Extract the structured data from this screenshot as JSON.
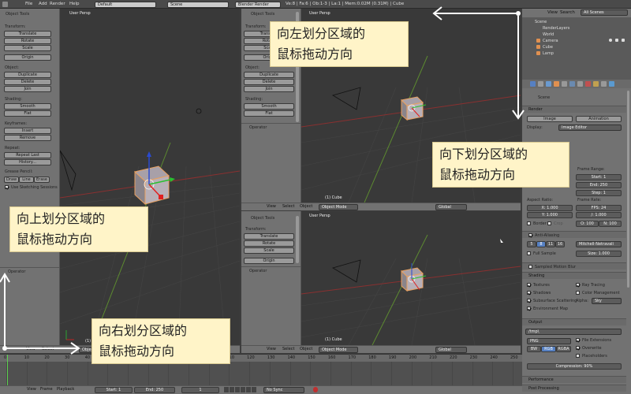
{
  "topbar": {
    "menus": [
      "File",
      "Add",
      "Render",
      "Help"
    ],
    "layout": "Default",
    "scene": "Scene",
    "engine": "Blender Render",
    "stats": "Ve:8 | Fa:6 | Ob:1-3 | La:1 | Mem:0.02M (0.31M) | Cube"
  },
  "tools_left": {
    "title": "Object Tools",
    "transform_label": "Transform:",
    "transform": [
      "Translate",
      "Rotate",
      "Scale"
    ],
    "origin": "Origin",
    "object_label": "Object:",
    "object": [
      "Duplicate",
      "Delete",
      "Join"
    ],
    "shading_label": "Shading:",
    "shading": [
      "Smooth",
      "Flat"
    ],
    "keyframes_label": "Keyframes:",
    "keyframes": [
      "Insert",
      "Remove"
    ],
    "repeat_label": "Repeat:",
    "repeat": [
      "Repeat Last",
      "History..."
    ],
    "grease_label": "Grease Pencil:",
    "grease": [
      "Draw",
      "Line",
      "Erase"
    ],
    "sketching": "Use Sketching Sessions",
    "operator": "Operator"
  },
  "tools_mid_top": {
    "title": "Object Tools",
    "transform_label": "Transform:",
    "transform": [
      "Translate",
      "Rotate",
      "Scale"
    ],
    "origin": "Origin",
    "object_label": "Object:",
    "object": [
      "Duplicate",
      "Delete",
      "Join"
    ],
    "shading_label": "Shading:",
    "shading": [
      "Smooth",
      "Flat"
    ],
    "operator": "Operator"
  },
  "tools_mid_bot": {
    "title": "Object Tools",
    "transform_label": "Transform:",
    "transform": [
      "Translate",
      "Rotate",
      "Scale"
    ],
    "origin": "Origin",
    "operator": "Operator"
  },
  "viewports": {
    "label": "User Persp",
    "cube_label": "(1) Cube",
    "menu_view": "View",
    "menu_select": "Select",
    "menu_object": "Object",
    "mode": "Object Mode",
    "orientation": "Global"
  },
  "outliner": {
    "view": "View",
    "search": "Search",
    "filter": "All Scenes",
    "items": [
      "Scene",
      "RenderLayers",
      "World",
      "Camera",
      "Cube",
      "Lamp"
    ]
  },
  "properties": {
    "breadcrumb": "Scene",
    "render": {
      "title": "Render",
      "image_btn": "Image",
      "animation_btn": "Animation",
      "display_label": "Display:",
      "display": "Image Editor"
    },
    "dimensions": {
      "frame_range": "Frame Range:",
      "start": "Start: 1",
      "end": "End: 250",
      "step": "Step: 1",
      "aspect": "Aspect Ratio:",
      "ax": "X: 1.000",
      "ay": "Y: 1.000",
      "frame_rate": "Frame Rate:",
      "fps": "FPS: 24",
      "fr": "/: 1.000",
      "border": "Border",
      "crop": "Crop",
      "old": "O: 100",
      "new": "N: 100"
    },
    "aa": {
      "title": "Anti-Aliasing",
      "samples": [
        "5",
        "8",
        "11",
        "16"
      ],
      "filter": "Mitchell-Netravali",
      "full_sample": "Full Sample",
      "size": "Size: 1.000"
    },
    "motion_blur": "Sampled Motion Blur",
    "shading": {
      "title": "Shading",
      "textures": "Textures",
      "shadows": "Shadows",
      "sss": "Subsurface Scattering",
      "env": "Environment Map",
      "ray": "Ray Tracing",
      "color": "Color Management",
      "alpha_label": "Alpha:",
      "alpha": "Sky"
    },
    "output": {
      "title": "Output",
      "path": "/tmp\\",
      "format": "PNG",
      "bw": "BW",
      "rgb": "RGB",
      "rgba": "RGBA",
      "file_ext": "File Extensions",
      "overwrite": "Overwrite",
      "placeholders": "Placeholders",
      "compression": "Compression: 90%"
    },
    "performance": "Performance",
    "post": "Post Processing"
  },
  "timeline": {
    "ticks": [
      "0",
      "10",
      "20",
      "30",
      "40",
      "50",
      "60",
      "70",
      "80",
      "90",
      "100",
      "110",
      "120",
      "130",
      "140",
      "150",
      "160",
      "170",
      "180",
      "190",
      "200",
      "210",
      "220",
      "230",
      "240",
      "250"
    ],
    "menus": [
      "View",
      "Frame",
      "Playback"
    ],
    "start": "Start: 1",
    "end": "End: 250",
    "current": "1",
    "sync": "No Sync"
  },
  "annotations": {
    "left": [
      "向左划分区域的",
      "鼠标拖动方向"
    ],
    "down": [
      "向下划分区域的",
      "鼠标拖动方向"
    ],
    "up": [
      "向上划分区域的",
      "鼠标拖动方向"
    ],
    "right": [
      "向右划分区域的",
      "鼠标拖动方向"
    ]
  },
  "colors": {
    "annotation_bg": "#fff4c8",
    "arrow": "#ffffff",
    "selected_blue": "#5680c2"
  }
}
